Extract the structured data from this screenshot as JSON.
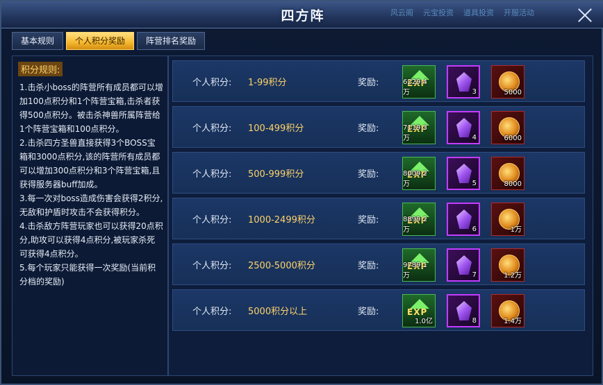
{
  "top_strip": [
    "风云阁",
    "元宝投资",
    "道具投资",
    "开服活动"
  ],
  "window": {
    "title": "四方阵"
  },
  "tabs": [
    {
      "label": "基本规则",
      "active": false
    },
    {
      "label": "个人积分奖励",
      "active": true
    },
    {
      "label": "阵营排名奖励",
      "active": false
    }
  ],
  "rules": {
    "heading": "积分规则:",
    "items": [
      "1.击杀小boss的阵营所有成员都可以增加100点积分和1个阵营宝箱,击杀者获得500点积分。被击杀神兽所属阵营给1个阵营宝箱和100点积分。",
      "2.击杀四方圣兽直接获得3个BOSS宝箱和3000点积分,该的阵营所有成员都可以增加300点积分和3个阵营宝箱,且获得服务器buff加成。",
      "3.每一次对boss造成伤害会获得2积分,无敌和护盾时攻击不会获得积分。",
      "4.击杀敌方阵营玩家也可以获得20点积分,助攻可以获得4点积分,被玩家杀死可获得4点积分。",
      "5.每个玩家只能获得一次奖励(当前积分档的奖励)"
    ]
  },
  "rewards": {
    "score_label": "个人积分:",
    "reward_label": "奖励:",
    "exp_icon_text": "EXP",
    "icons": [
      "exp-icon",
      "purple-crystal-icon",
      "gold-medal-icon"
    ],
    "rows": [
      {
        "range": "1-99积分",
        "exp": "6229.4万",
        "crystal": "3",
        "medal": "5000"
      },
      {
        "range": "100-499积分",
        "exp": "7119.3万",
        "crystal": "4",
        "medal": "6000"
      },
      {
        "range": "500-999积分",
        "exp": "8009.2万",
        "crystal": "5",
        "medal": "8000"
      },
      {
        "range": "1000-2499积分",
        "exp": "8899.2万",
        "crystal": "6",
        "medal": "1万"
      },
      {
        "range": "2500-5000积分",
        "exp": "9789.1万",
        "crystal": "7",
        "medal": "1.2万"
      },
      {
        "range": "5000积分以上",
        "exp": "1.0亿",
        "crystal": "8",
        "medal": "1.4万"
      }
    ]
  }
}
